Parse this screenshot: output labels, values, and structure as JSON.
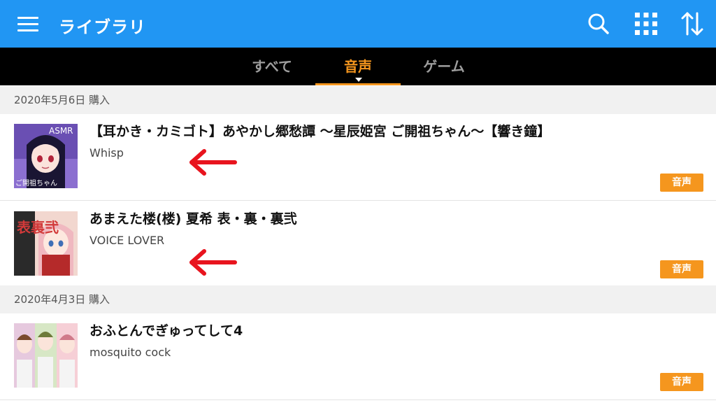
{
  "appbar": {
    "title": "ライブラリ",
    "icons": [
      "hamburger-menu-icon",
      "search-icon",
      "grid-icon",
      "sort-icon"
    ]
  },
  "tabs": [
    {
      "label": "すべて",
      "active": false
    },
    {
      "label": "音声",
      "active": true
    },
    {
      "label": "ゲーム",
      "active": false
    }
  ],
  "groups": [
    {
      "date": "2020年5月6日 購入",
      "items": [
        {
          "title": "【耳かき・カミゴト】あやかし郷愁譚 〜星辰姫宮 ご開祖ちゃん〜【響き鐘】",
          "maker": "Whisp",
          "badge": "音声",
          "thumb_text": "ASMR",
          "thumb_caption": "ご開祖ちゃん"
        },
        {
          "title": "あまえた楼(楼) 夏希 表・裏・裏弐",
          "maker": "VOICE LOVER",
          "badge": "音声",
          "thumb_text": "表裏弐"
        }
      ]
    },
    {
      "date": "2020年4月3日 購入",
      "items": [
        {
          "title": "おふとんでぎゅってして4",
          "maker": "mosquito cock",
          "badge": "音声"
        }
      ]
    }
  ],
  "colors": {
    "appbar": "#2196f3",
    "tabbar": "#000000",
    "accent": "#f5961e",
    "annotation_arrow": "#e8141e"
  }
}
